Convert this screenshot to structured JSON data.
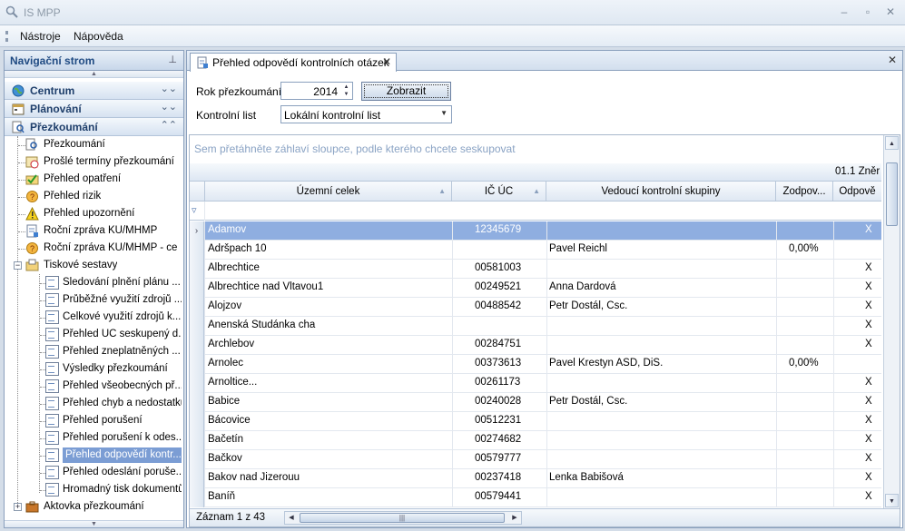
{
  "window": {
    "title": "IS MPP",
    "minimize": "–",
    "maximize": "▫",
    "close": "✕"
  },
  "menu": [
    {
      "label": "Nástroje"
    },
    {
      "label": "Nápověda"
    }
  ],
  "nav": {
    "title": "Navigační strom",
    "groups": [
      {
        "label": "Centrum",
        "chevron": "⌄⌄"
      },
      {
        "label": "Plánování",
        "chevron": "⌄⌄"
      },
      {
        "label": "Přezkoumání",
        "chevron": "⌃⌃"
      }
    ],
    "items": [
      {
        "label": "Přezkoumání"
      },
      {
        "label": "Prošlé termíny přezkoumání"
      },
      {
        "label": "Přehled opatření"
      },
      {
        "label": "Přehled rizik"
      },
      {
        "label": "Přehled upozornění"
      },
      {
        "label": "Roční zpráva KÚ/MHMP"
      },
      {
        "label": "Roční zpráva KÚ/MHMP - ce..."
      },
      {
        "label": "Tiskové sestavy"
      }
    ],
    "reports": [
      {
        "label": "Sledování plnění plánu ..."
      },
      {
        "label": "Průběžné využití zdrojů ..."
      },
      {
        "label": "Celkové využití zdrojů k..."
      },
      {
        "label": "Přehled ÚC seskupený d..."
      },
      {
        "label": "Přehled zneplatněných ..."
      },
      {
        "label": "Výsledky přezkoumání"
      },
      {
        "label": "Přehled všeobecných př..."
      },
      {
        "label": "Přehled chyb a nedostatků"
      },
      {
        "label": "Přehled porušení"
      },
      {
        "label": "Přehled porušení k odes..."
      },
      {
        "label": "Přehled odpovědí kontr..."
      },
      {
        "label": "Přehled odeslání poruše..."
      },
      {
        "label": "Hromadný tisk dokumentů"
      }
    ],
    "last_item": {
      "label": "Aktovka přezkoumání"
    }
  },
  "tab": {
    "label": "Přehled odpovědí kontrolních otázek",
    "close": "✕"
  },
  "panel_close": "✕",
  "form": {
    "year_label": "Rok přezkoumání",
    "year_value": "2014",
    "show_button": "Zobrazit",
    "checklist_label": "Kontrolní list",
    "checklist_value": "Lokální kontrolní list"
  },
  "grid": {
    "group_hint": "Sem přetáhněte záhlaví sloupce, podle kterého chcete seskupovat",
    "band_label": "01.1 Zněr",
    "columns": [
      {
        "label": "Územní celek"
      },
      {
        "label": "IČ ÚC"
      },
      {
        "label": "Vedoucí kontrolní skupiny"
      },
      {
        "label": "Zodpov..."
      },
      {
        "label": "Odpově"
      }
    ],
    "rows": [
      {
        "celek": "Adamov",
        "ic": "12345679",
        "vedouci": "",
        "zodp": "",
        "odp": "X",
        "selected": true
      },
      {
        "celek": "Adršpach 10",
        "ic": "",
        "vedouci": "Pavel Reichl",
        "zodp": "0,00%",
        "odp": ""
      },
      {
        "celek": "Albrechtice",
        "ic": "00581003",
        "vedouci": "",
        "zodp": "",
        "odp": "X"
      },
      {
        "celek": "Albrechtice nad  Vltavou1",
        "ic": "00249521",
        "vedouci": "Anna Dardová",
        "zodp": "",
        "odp": "X"
      },
      {
        "celek": "Alojzov",
        "ic": "00488542",
        "vedouci": "Petr Dostál, Csc.",
        "zodp": "",
        "odp": "X"
      },
      {
        "celek": "Anenská Studánka cha",
        "ic": "",
        "vedouci": "",
        "zodp": "",
        "odp": "X"
      },
      {
        "celek": "Archlebov",
        "ic": "00284751",
        "vedouci": "",
        "zodp": "",
        "odp": "X"
      },
      {
        "celek": "Arnolec",
        "ic": "00373613",
        "vedouci": "Pavel Krestyn ASD, DiS.",
        "zodp": "0,00%",
        "odp": ""
      },
      {
        "celek": "Arnoltice...",
        "ic": "00261173",
        "vedouci": "",
        "zodp": "",
        "odp": "X"
      },
      {
        "celek": "Babice",
        "ic": "00240028",
        "vedouci": "Petr Dostál, Csc.",
        "zodp": "",
        "odp": "X"
      },
      {
        "celek": "Bácovice",
        "ic": "00512231",
        "vedouci": "",
        "zodp": "",
        "odp": "X"
      },
      {
        "celek": "Bačetín",
        "ic": "00274682",
        "vedouci": "",
        "zodp": "",
        "odp": "X"
      },
      {
        "celek": "Bačkov",
        "ic": "00579777",
        "vedouci": "",
        "zodp": "",
        "odp": "X"
      },
      {
        "celek": "Bakov nad Jizerouu",
        "ic": "00237418",
        "vedouci": "Lenka Babišová",
        "zodp": "",
        "odp": "X"
      },
      {
        "celek": "Baníň",
        "ic": "00579441",
        "vedouci": "",
        "zodp": "",
        "odp": "X"
      }
    ],
    "record_info": "Záznam 1 z 43"
  }
}
